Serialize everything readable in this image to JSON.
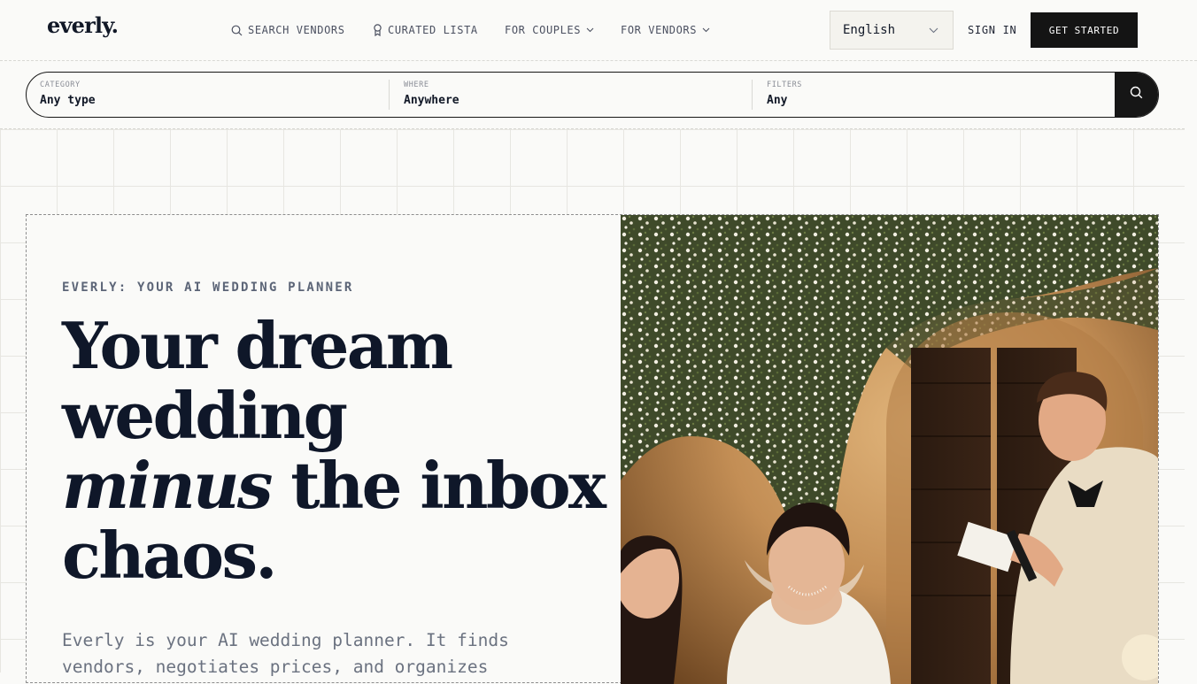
{
  "header": {
    "logo": "everly.",
    "nav": {
      "search_vendors": "SEARCH VENDORS",
      "curated_lista": "CURATED LISTA",
      "for_couples": "FOR COUPLES",
      "for_vendors": "FOR VENDORS"
    },
    "language": {
      "selected": "English"
    },
    "sign_in": "SIGN IN",
    "get_started": "GET STARTED"
  },
  "search": {
    "category": {
      "label": "CATEGORY",
      "value": "Any type"
    },
    "where": {
      "label": "WHERE",
      "value": "Anywhere"
    },
    "filters": {
      "label": "FILTERS",
      "value": "Any"
    },
    "button_icon": "search-icon"
  },
  "hero": {
    "eyebrow": "EVERLY: YOUR AI WEDDING PLANNER",
    "headline": {
      "line1": "Your dream",
      "line2": "wedding",
      "line3_italic": "minus",
      "line3_rest": " the inbox",
      "line4": "chaos."
    },
    "body": "Everly is your AI wedding planner. It finds vendors, negotiates prices, and organizes"
  },
  "icons": {
    "nav_search": "search-icon",
    "nav_curated": "bookmark-icon",
    "dropdown": "chevron-down-icon"
  },
  "colors": {
    "background": "#fafaf8",
    "ink": "#0f1729",
    "button": "#141414",
    "muted": "#6b7280"
  }
}
